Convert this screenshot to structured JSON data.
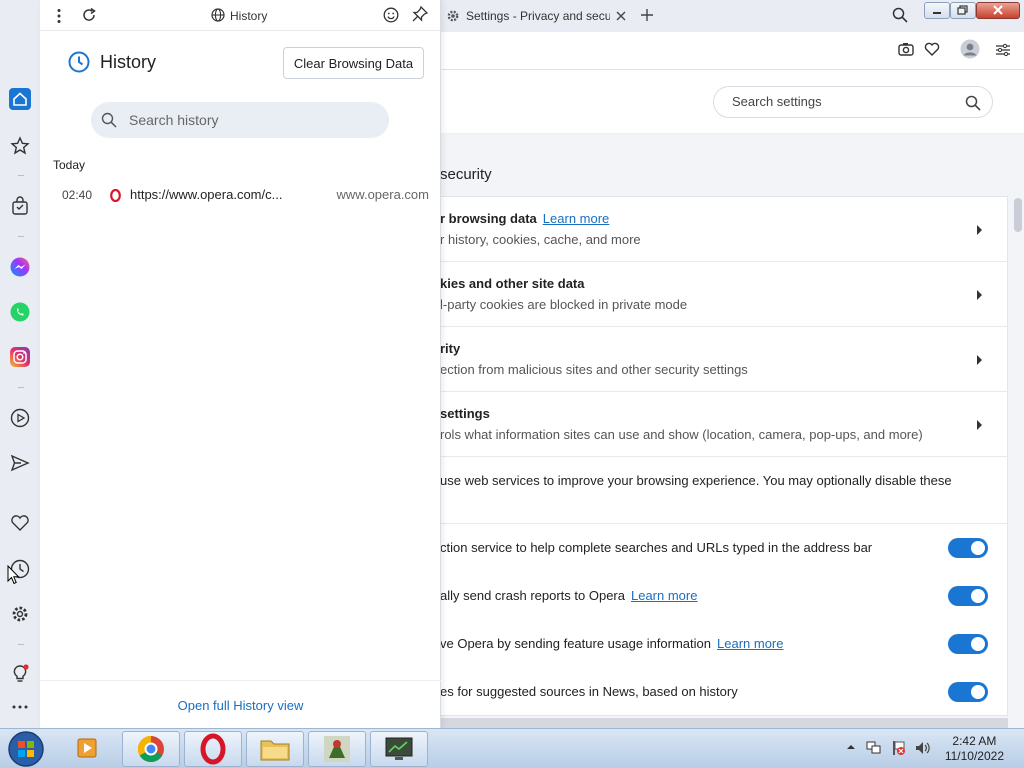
{
  "window": {
    "tab_title": "Settings - Privacy and secu",
    "settings_search_placeholder": "Search settings"
  },
  "history_panel": {
    "toolbar_title": "History",
    "title": "History",
    "clear_button": "Clear Browsing Data",
    "search_placeholder": "Search history",
    "section_today": "Today",
    "entries": [
      {
        "time": "02:40",
        "url": "https://www.opera.com/c...",
        "domain": "www.opera.com"
      }
    ],
    "open_full": "Open full History view"
  },
  "settings": {
    "section_title": "security",
    "rows": [
      {
        "title": "r browsing data",
        "link": "Learn more",
        "subtitle": "r history, cookies, cache, and more"
      },
      {
        "title": "kies and other site data",
        "link": "",
        "subtitle": "l-party cookies are blocked in private mode"
      },
      {
        "title": "rity",
        "link": "",
        "subtitle": "ection from malicious sites and other security settings"
      },
      {
        "title": "settings",
        "link": "",
        "subtitle": "rols what information sites can use and show (location, camera, pop-ups, and more)"
      }
    ],
    "note": "use web services to improve your browsing experience. You may optionally disable these",
    "toggles": [
      {
        "text": "ction service to help complete searches and URLs typed in the address bar",
        "link": "",
        "on": true
      },
      {
        "text": "ally send crash reports to Opera",
        "link": "Learn more",
        "on": true
      },
      {
        "text": "ve Opera by sending feature usage information",
        "link": "Learn more",
        "on": true
      },
      {
        "text": "es for suggested sources in News, based on history",
        "link": "",
        "on": true
      }
    ]
  },
  "taskbar": {
    "time": "2:42 AM",
    "date": "11/10/2022"
  },
  "colors": {
    "accent": "#1b76d3",
    "opera_red": "#d61628",
    "link": "#1a6fbf"
  }
}
